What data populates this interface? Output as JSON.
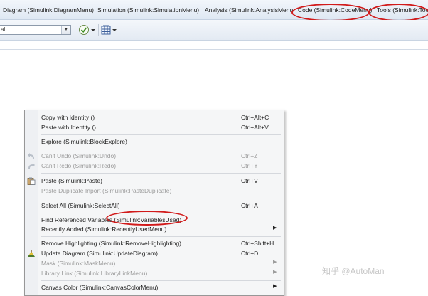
{
  "menubar": {
    "items": [
      "Diagram (Simulink:DiagramMenu)",
      "Simulation (Simulink:SimulationMenu)",
      "Analysis (Simulink:AnalysisMenu",
      "Code (Simulink:CodeMenu)",
      "Tools (Simulink:Too"
    ],
    "highlight_color": "#d11a1a"
  },
  "toolbar": {
    "mode_combo_value": "al"
  },
  "context_menu": {
    "items": [
      {
        "label": "Copy with Identity ()",
        "shortcut": "Ctrl+Alt+C",
        "enabled": true
      },
      {
        "label": "Paste with Identity ()",
        "shortcut": "Ctrl+Alt+V",
        "enabled": true
      },
      {
        "label": "Explore (Simulink:BlockExplore)",
        "shortcut": "",
        "enabled": true
      },
      {
        "label": "Can't Undo (Simulink:Undo)",
        "shortcut": "Ctrl+Z",
        "enabled": false,
        "icon": "undo-icon"
      },
      {
        "label": "Can't Redo (Simulink:Redo)",
        "shortcut": "Ctrl+Y",
        "enabled": false,
        "icon": "redo-icon"
      },
      {
        "label": "Paste (Simulink:Paste)",
        "shortcut": "Ctrl+V",
        "enabled": true,
        "icon": "paste-icon"
      },
      {
        "label": "Paste Duplicate Inport (Simulink:PasteDuplicate)",
        "shortcut": "",
        "enabled": false
      },
      {
        "label": "Select All (Simulink:SelectAll)",
        "shortcut": "Ctrl+A",
        "enabled": true
      },
      {
        "label": "Find Referenced Variables (Simulink:VariablesUsed)",
        "shortcut": "",
        "enabled": true
      },
      {
        "label": "Recently Added (Simulink:RecentlyUsedMenu)",
        "shortcut": "",
        "enabled": true,
        "submenu": true
      },
      {
        "label": "Remove Highlighting (Simulink:RemoveHighlighting)",
        "shortcut": "Ctrl+Shift+H",
        "enabled": true
      },
      {
        "label": "Update Diagram (Simulink:UpdateDiagram)",
        "shortcut": "Ctrl+D",
        "enabled": true,
        "icon": "update-diagram-icon"
      },
      {
        "label": "Mask (Simulink:MaskMenu)",
        "shortcut": "",
        "enabled": false,
        "submenu": true
      },
      {
        "label": "Library Link (Simulink:LibraryLinkMenu)",
        "shortcut": "",
        "enabled": false,
        "submenu": true
      },
      {
        "label": "Canvas Color (Simulink:CanvasColorMenu)",
        "shortcut": "",
        "enabled": true,
        "submenu": true
      }
    ]
  },
  "watermark": "知乎 @AutoMan"
}
